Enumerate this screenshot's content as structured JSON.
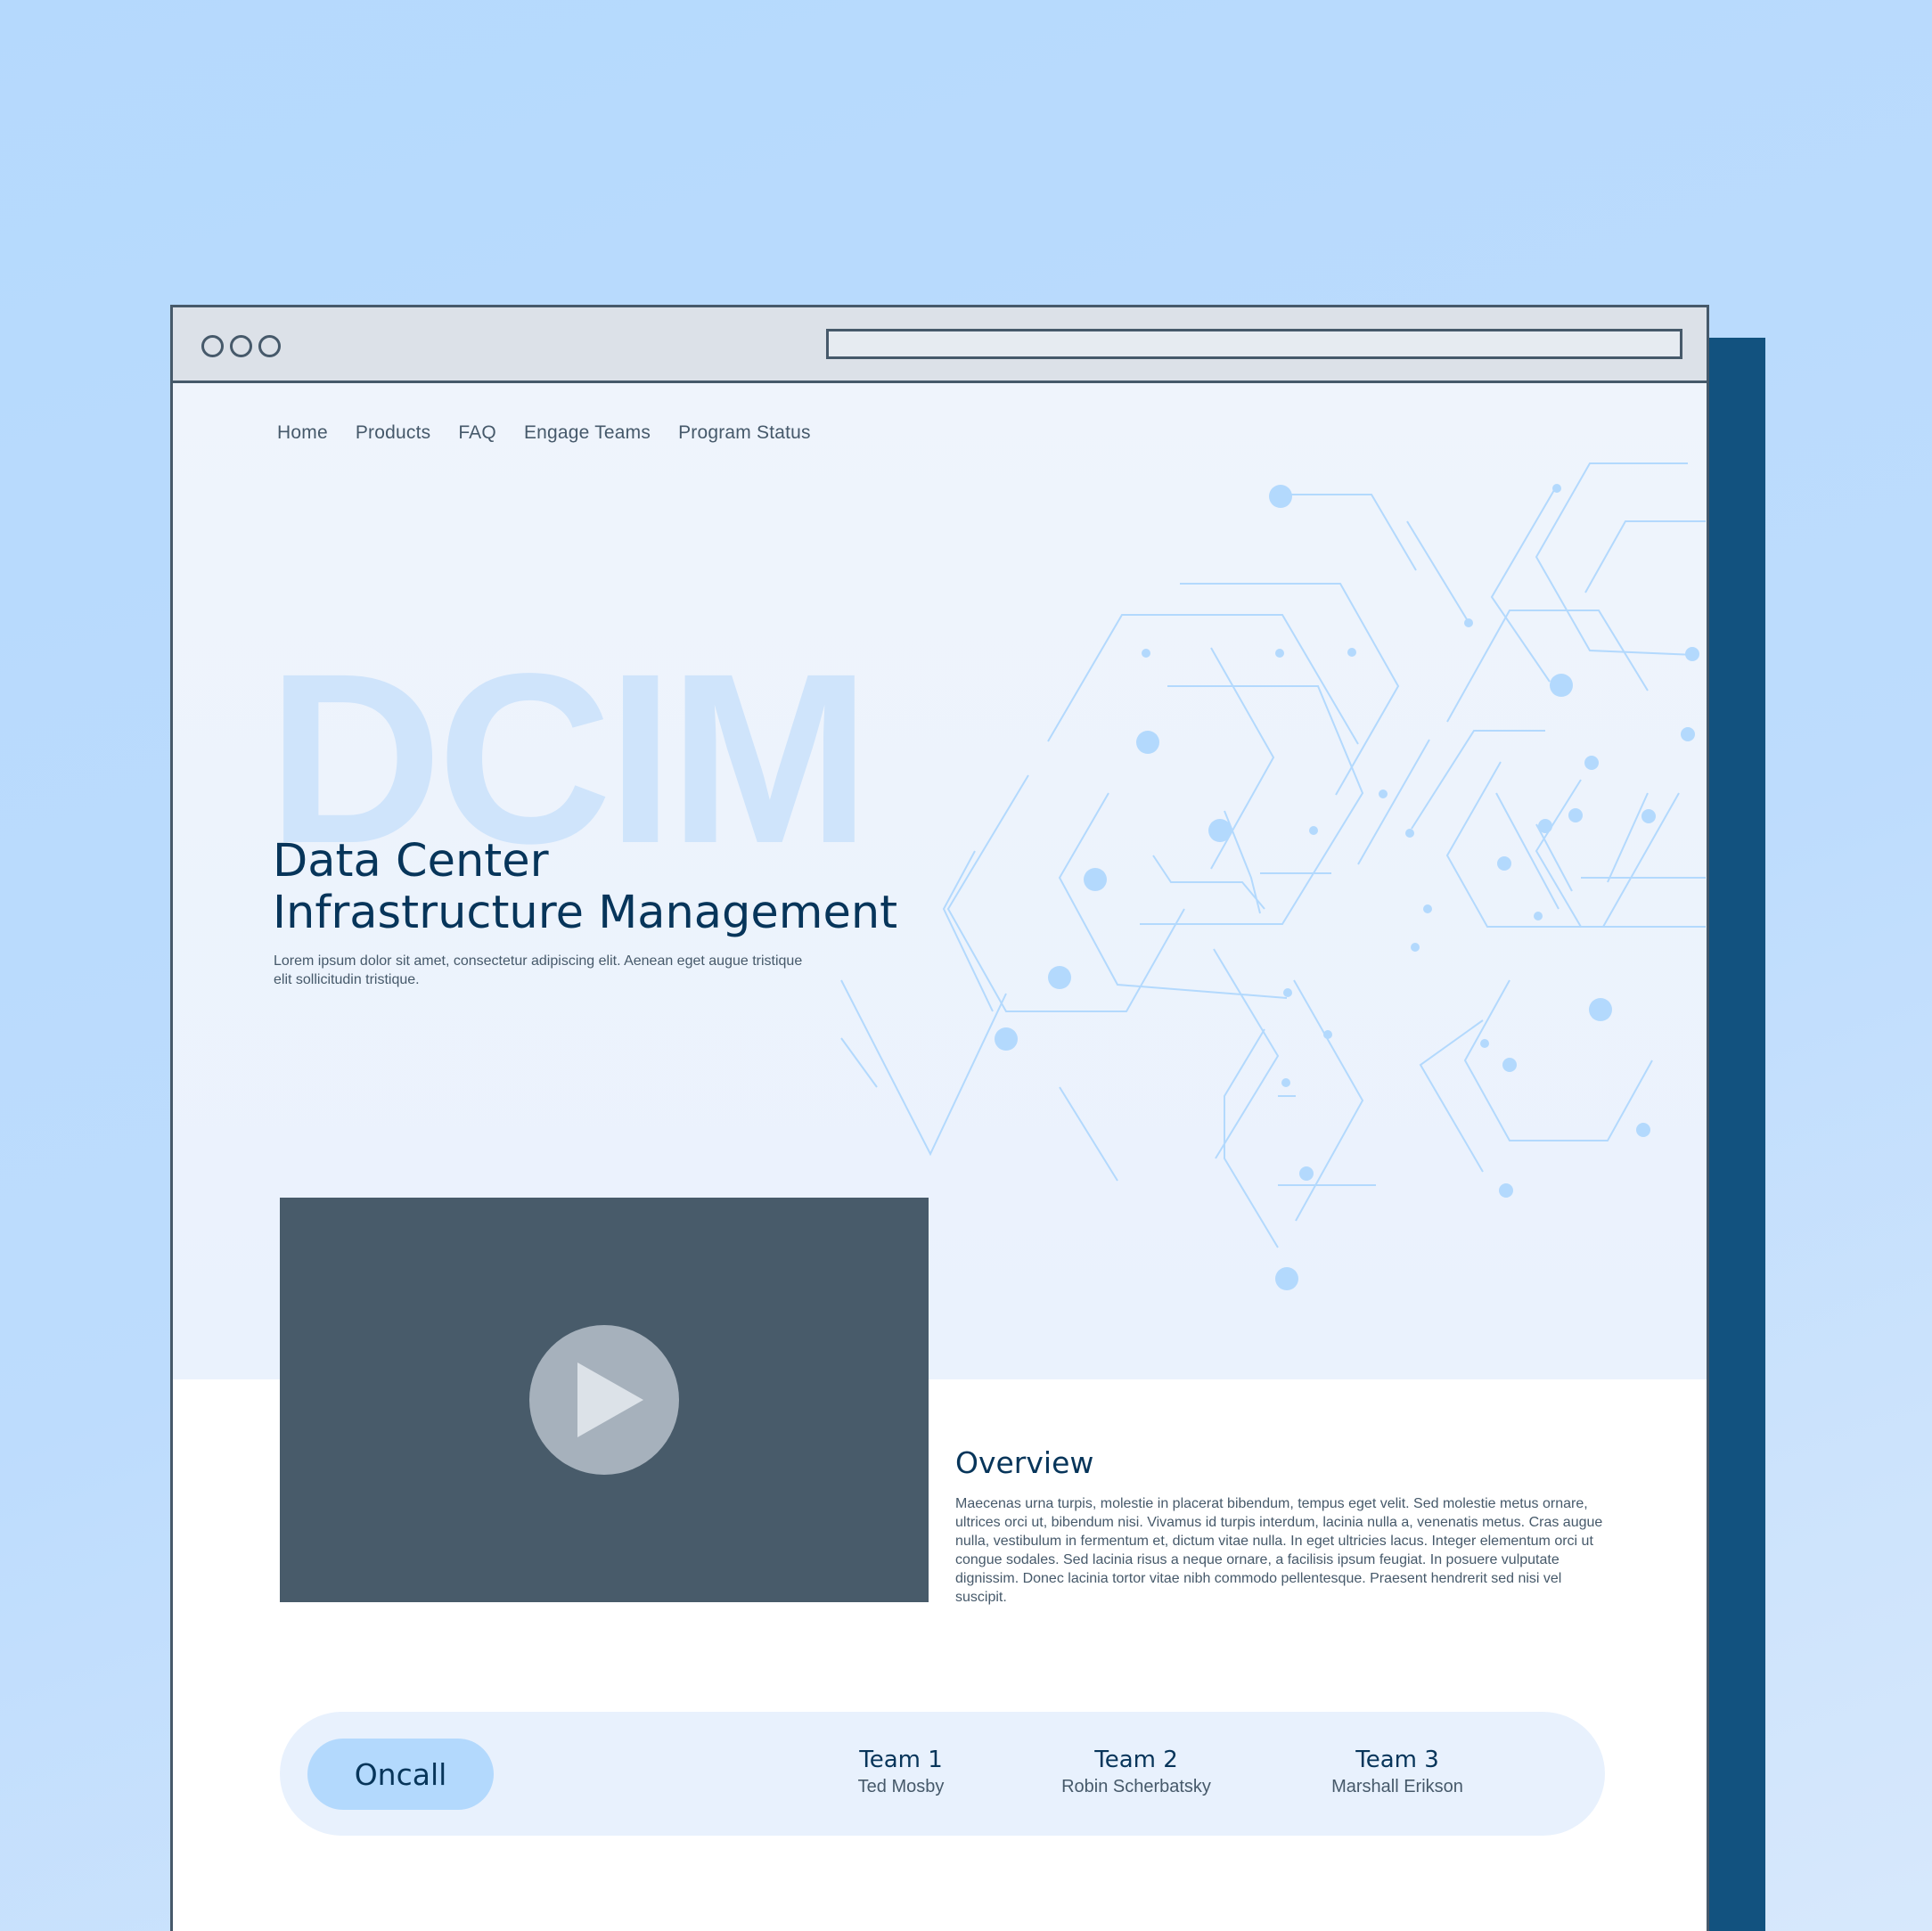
{
  "nav": {
    "items": [
      {
        "label": "Home"
      },
      {
        "label": "Products"
      },
      {
        "label": "FAQ"
      },
      {
        "label": "Engage Teams"
      },
      {
        "label": "Program Status"
      }
    ]
  },
  "hero": {
    "watermark": "DCIM",
    "title_line1": "Data Center",
    "title_line2": "Infrastructure Management",
    "description": "Lorem ipsum dolor sit amet, consectetur adipiscing elit. Aenean eget augue tristique elit sollicitudin tristique."
  },
  "overview": {
    "title": "Overview",
    "text": "Maecenas urna turpis, molestie in placerat bibendum, tempus eget velit. Sed molestie metus ornare, ultrices orci ut, bibendum nisi. Vivamus id turpis interdum, lacinia nulla a, venenatis metus. Cras augue nulla, vestibulum in fermentum et, dictum vitae nulla. In eget ultricies lacus. Integer elementum orci ut congue sodales. Sed lacinia risus a neque ornare, a facilisis ipsum feugiat. In posuere vulputate dignissim. Donec lacinia tortor vitae nibh commodo pellentesque. Praesent hendrerit sed nisi vel suscipit."
  },
  "oncall": {
    "button_label": "Oncall",
    "teams": [
      {
        "name": "Team 1",
        "person": "Ted Mosby"
      },
      {
        "name": "Team 2",
        "person": "Robin Scherbatsky"
      },
      {
        "name": "Team 3",
        "person": "Marshall Erikson"
      }
    ]
  },
  "colors": {
    "accent": "#b3d9fd",
    "heading": "#07355a",
    "body_text": "#46596a",
    "frame": "#46596a",
    "side_panel": "#12527f",
    "video_bg": "#485b6a"
  },
  "icons": {
    "window_controls": "window-control-circles",
    "play": "play-icon",
    "background": "network-graph-illustration"
  }
}
